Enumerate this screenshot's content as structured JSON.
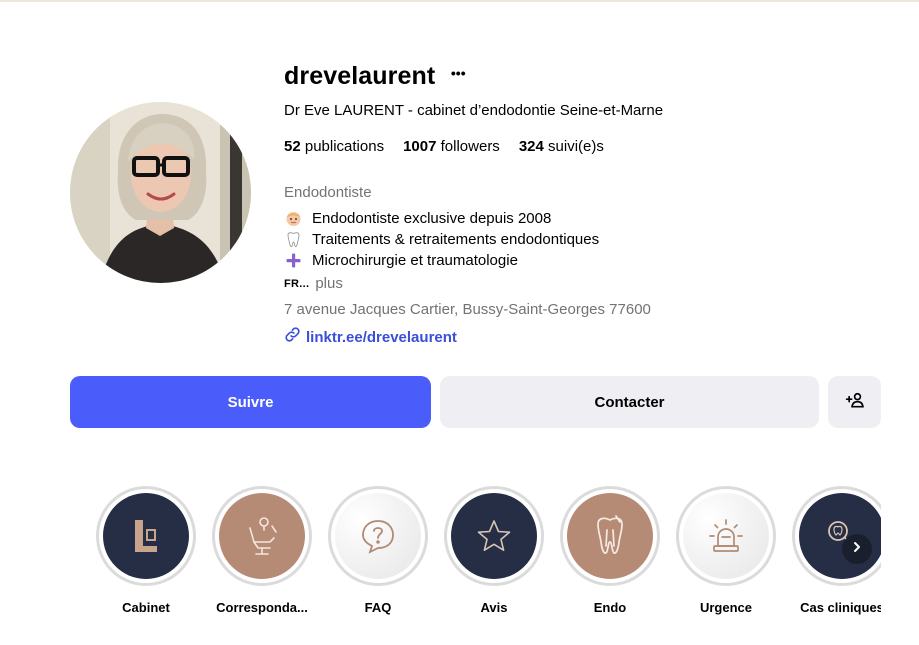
{
  "profile": {
    "username": "drevelaurent",
    "more_icon": "more-horizontal-icon",
    "full_name": "Dr Eve LAURENT - cabinet d’endodontie Seine-et-Marne",
    "stats": [
      {
        "count": "52",
        "label": "publications"
      },
      {
        "count": "1007",
        "label": "followers"
      },
      {
        "count": "324",
        "label": "suivi(e)s"
      }
    ],
    "category": "Endodontiste",
    "bio": [
      {
        "icon": "baby-face-emoji-icon",
        "text": "Endodontiste exclusive depuis 2008"
      },
      {
        "icon": "tooth-emoji-icon",
        "text": "Traitements & retraitements endodontiques"
      },
      {
        "icon": "purple-plus-emoji-icon",
        "text": "Microchirurgie et traumatologie"
      }
    ],
    "more_prefix": "FR...",
    "more_label": "plus",
    "address": "7 avenue Jacques Cartier, Bussy-Saint-Georges 77600",
    "link": "linktr.ee/drevelaurent",
    "link_icon": "link-icon"
  },
  "actions": {
    "follow_label": "Suivre",
    "contact_label": "Contacter",
    "add_user_icon": "add-user-icon"
  },
  "highlights": [
    {
      "label": "Cabinet",
      "icon": "logo-l-icon"
    },
    {
      "label": "Correspondants",
      "display": "Corresponda...",
      "icon": "dental-chair-icon"
    },
    {
      "label": "FAQ",
      "icon": "question-bubble-icon"
    },
    {
      "label": "Avis",
      "icon": "star-icon"
    },
    {
      "label": "Endo",
      "icon": "tooth-icon"
    },
    {
      "label": "Urgence",
      "icon": "siren-icon"
    },
    {
      "label": "Cas cliniques",
      "icon": "magnifier-tooth-icon"
    }
  ],
  "colors": {
    "follow_button": "#4a5dfb",
    "secondary_button": "#efeff3",
    "link": "#3a4fd8",
    "muted_text": "#737373",
    "highlight_navy": "#252e45",
    "highlight_brown": "#b68b76"
  }
}
